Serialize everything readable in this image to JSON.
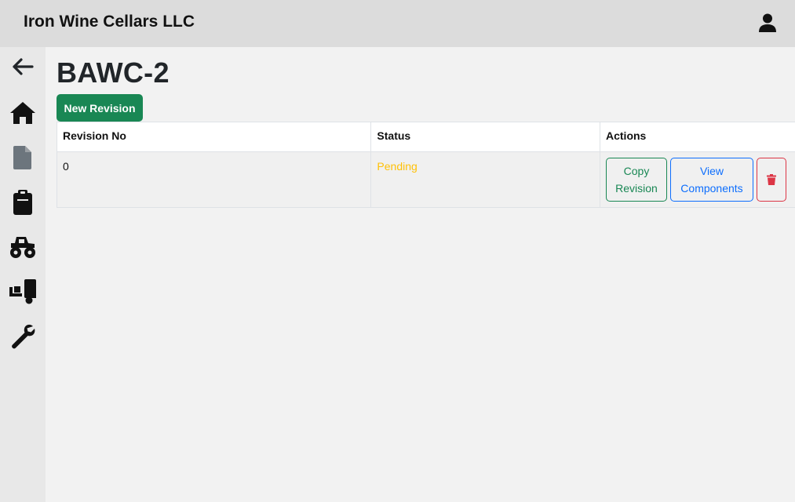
{
  "header": {
    "company_name": "Iron Wine Cellars LLC",
    "user_icon": "user-icon"
  },
  "sidebar": {
    "items": [
      {
        "icon": "arrow-left-icon"
      },
      {
        "icon": "home-icon"
      },
      {
        "icon": "document-icon"
      },
      {
        "icon": "clipboard-icon"
      },
      {
        "icon": "monster-truck-icon"
      },
      {
        "icon": "dolly-icon"
      },
      {
        "icon": "wrench-icon"
      }
    ]
  },
  "main": {
    "title": "BAWC-2",
    "new_revision_label": "New Revision",
    "table": {
      "headers": [
        "Revision No",
        "Status",
        "Actions"
      ],
      "rows": [
        {
          "revision_no": "0",
          "status": "Pending",
          "copy_label_line1": "Copy",
          "copy_label_line2": "Revision",
          "view_label_line1": "View",
          "view_label_line2": "Components",
          "delete_icon": "trash-icon"
        }
      ]
    }
  },
  "colors": {
    "primary_green": "#198754",
    "primary_blue": "#0d6efd",
    "danger_red": "#dc3545",
    "pending_yellow": "#ffc107"
  }
}
